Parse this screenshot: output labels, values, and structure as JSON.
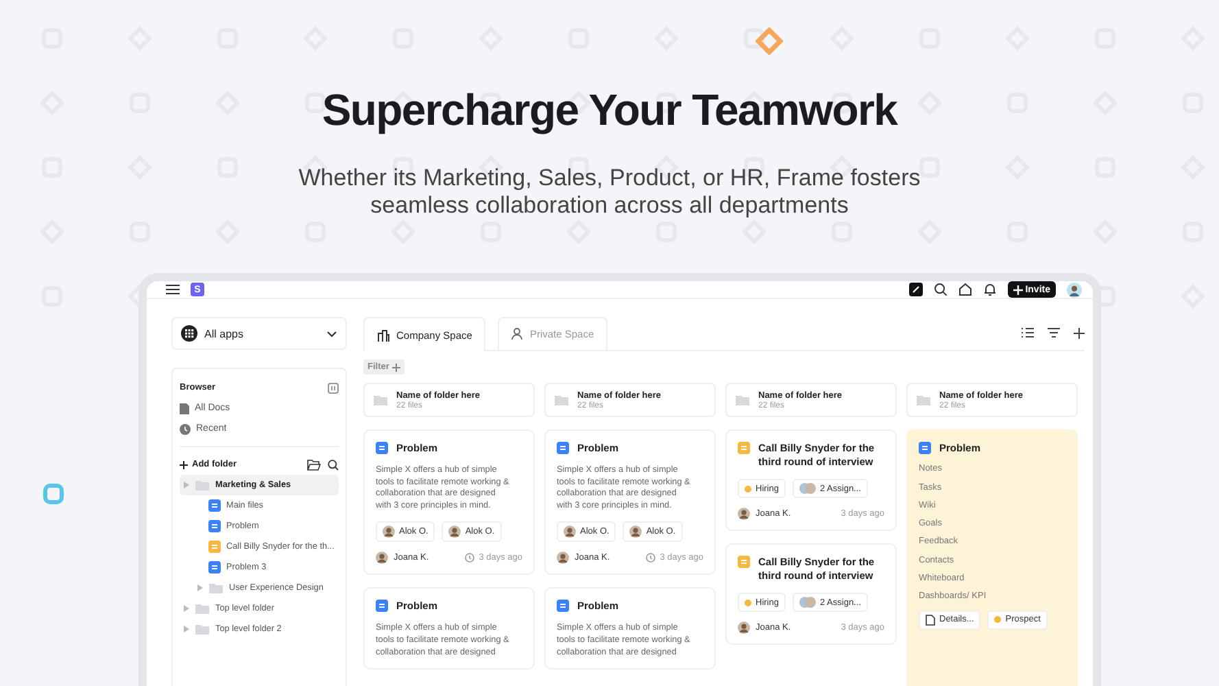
{
  "hero": {
    "title": "Supercharge Your Teamwork",
    "subtitle": "Whether its Marketing, Sales, Product, or HR, Frame fosters seamless collaboration across all departments"
  },
  "topbar": {
    "logo": "S",
    "invite": "Invite"
  },
  "app_selector": {
    "label": "All apps"
  },
  "tabs": [
    {
      "label": "Company Space",
      "selected": true
    },
    {
      "label": "Private Space",
      "selected": false
    }
  ],
  "filter": {
    "label": "Filter"
  },
  "sidebar": {
    "title": "Browser",
    "nav": [
      {
        "label": "All Docs",
        "kind": "docs"
      },
      {
        "label": "Recent",
        "kind": "recent"
      }
    ],
    "add_folder": "Add folder",
    "tree": [
      {
        "label": "Marketing & Sales",
        "kind": "folder",
        "selected": true,
        "children": [
          {
            "label": "Main files",
            "kind": "doc",
            "color": "#3b82f6",
            "selected": false
          },
          {
            "label": "Problem",
            "kind": "doc",
            "color": "#3b82f6",
            "selected": false
          },
          {
            "label": "Call Billy Snyder for the th...",
            "kind": "doc",
            "color": "#f5b942",
            "selected": false
          },
          {
            "label": "Problem 3",
            "kind": "doc",
            "color": "#3b82f6",
            "selected": false
          },
          {
            "label": "User Experience Design",
            "kind": "folder",
            "selected": false
          }
        ]
      },
      {
        "label": "Top level folder",
        "kind": "folder",
        "selected": false
      },
      {
        "label": "Top level folder 2",
        "kind": "folder",
        "selected": false
      }
    ]
  },
  "folders": [
    {
      "name": "Name of folder here",
      "count": "22 files"
    },
    {
      "name": "Name of folder here",
      "count": "22 files"
    },
    {
      "name": "Name of folder here",
      "count": "22 files"
    },
    {
      "name": "Name of folder here",
      "count": "22 files"
    }
  ],
  "columns": [
    [
      {
        "kind": "doc",
        "title": "Problem",
        "body": "Simple X offers a hub of simple tools to facilitate remote working & collaboration that are designed with 3 core principles in mind.",
        "assignees": [
          "Alok O.",
          "Alok O."
        ],
        "author": "Joana K.",
        "time": "3 days ago"
      },
      {
        "kind": "doc",
        "title": "Problem",
        "body": "Simple X offers a hub of simple tools to facilitate remote working & collaboration that are designed"
      }
    ],
    [
      {
        "kind": "doc",
        "title": "Problem",
        "body": "Simple X offers a hub of simple tools to facilitate remote working & collaboration that are designed with 3 core principles in mind.",
        "assignees": [
          "Alok O.",
          "Alok O."
        ],
        "author": "Joana K.",
        "time": "3 days ago"
      },
      {
        "kind": "doc",
        "title": "Problem",
        "body": "Simple X offers a hub of simple tools to facilitate remote working & collaboration that are designed"
      }
    ],
    [
      {
        "kind": "task",
        "title": "Call Billy Snyder for the third round of interview",
        "tag": {
          "label": "Hiring",
          "color": "#f5b942"
        },
        "assignees_label": "2 Assign...",
        "author": "Joana K.",
        "time": "3 days ago"
      },
      {
        "kind": "task",
        "title": "Call Billy Snyder for the third round of interview",
        "tag": {
          "label": "Hiring",
          "color": "#f5b942"
        },
        "assignees_label": "2 Assign...",
        "author": "Joana K.",
        "time": "3 days ago"
      }
    ],
    [
      {
        "kind": "menu",
        "title": "Problem",
        "items": [
          "Notes",
          "Tasks",
          "Wiki",
          "Goals",
          "Feedback",
          "Contacts",
          "Whiteboard",
          "Dashboards/ KPI"
        ],
        "chips": [
          {
            "kind": "doc",
            "label": "Details..."
          },
          {
            "kind": "status",
            "label": "Prospect",
            "color": "#f5b942"
          }
        ]
      }
    ]
  ]
}
